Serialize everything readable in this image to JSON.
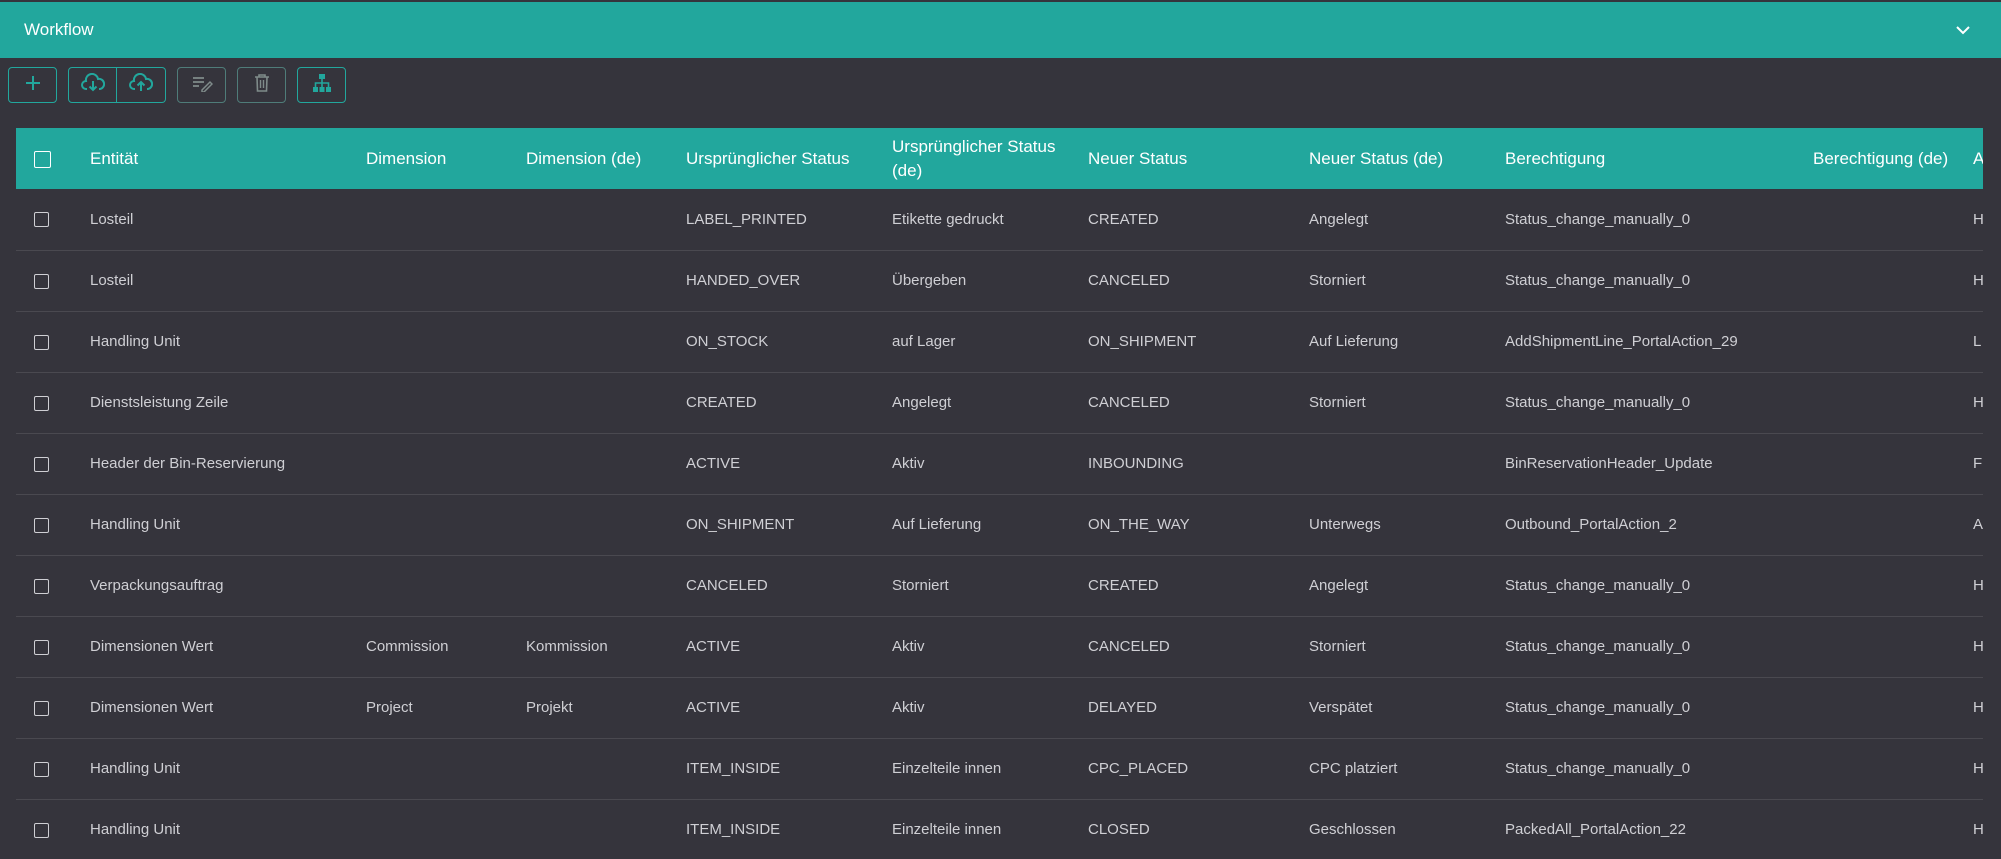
{
  "panel": {
    "title": "Workflow",
    "collapse_icon": "chevron-down-icon"
  },
  "toolbar": {
    "buttons": [
      {
        "name": "add-button",
        "icon": "plus-icon"
      },
      {
        "name": "download-button",
        "icon": "cloud-download-icon"
      },
      {
        "name": "upload-button",
        "icon": "cloud-upload-icon"
      },
      {
        "name": "edit-button",
        "icon": "edit-list-icon"
      },
      {
        "name": "delete-button",
        "icon": "trash-icon"
      },
      {
        "name": "hierarchy-button",
        "icon": "sitemap-icon"
      }
    ]
  },
  "colors": {
    "accent": "#22a79d",
    "background": "#35343c",
    "text": "#cfcfd4"
  },
  "table": {
    "columns": [
      "Entität",
      "Dimension",
      "Dimension (de)",
      "Ursprünglicher Status",
      "Ursprünglicher Status (de)",
      "Neuer Status",
      "Neuer Status (de)",
      "Berechtigung",
      "Berechtigung (de)",
      "A"
    ],
    "rows": [
      [
        "Losteil",
        "",
        "",
        "LABEL_PRINTED",
        "Etikette gedruckt",
        "CREATED",
        "Angelegt",
        "Status_change_manually_0",
        "",
        "H"
      ],
      [
        "Losteil",
        "",
        "",
        "HANDED_OVER",
        "Übergeben",
        "CANCELED",
        "Storniert",
        "Status_change_manually_0",
        "",
        "H"
      ],
      [
        "Handling Unit",
        "",
        "",
        "ON_STOCK",
        "auf Lager",
        "ON_SHIPMENT",
        "Auf Lieferung",
        "AddShipmentLine_PortalAction_29",
        "",
        "L"
      ],
      [
        "Dienstsleistung Zeile",
        "",
        "",
        "CREATED",
        "Angelegt",
        "CANCELED",
        "Storniert",
        "Status_change_manually_0",
        "",
        "H"
      ],
      [
        "Header der Bin-Reservierung",
        "",
        "",
        "ACTIVE",
        "Aktiv",
        "INBOUNDING",
        "",
        "BinReservationHeader_Update",
        "",
        "F"
      ],
      [
        "Handling Unit",
        "",
        "",
        "ON_SHIPMENT",
        "Auf Lieferung",
        "ON_THE_WAY",
        "Unterwegs",
        "Outbound_PortalAction_2",
        "",
        "A"
      ],
      [
        "Verpackungsauftrag",
        "",
        "",
        "CANCELED",
        "Storniert",
        "CREATED",
        "Angelegt",
        "Status_change_manually_0",
        "",
        "H"
      ],
      [
        "Dimensionen Wert",
        "Commission",
        "Kommission",
        "ACTIVE",
        "Aktiv",
        "CANCELED",
        "Storniert",
        "Status_change_manually_0",
        "",
        "H"
      ],
      [
        "Dimensionen Wert",
        "Project",
        "Projekt",
        "ACTIVE",
        "Aktiv",
        "DELAYED",
        "Verspätet",
        "Status_change_manually_0",
        "",
        "H"
      ],
      [
        "Handling Unit",
        "",
        "",
        "ITEM_INSIDE",
        "Einzelteile innen",
        "CPC_PLACED",
        "CPC platziert",
        "Status_change_manually_0",
        "",
        "H"
      ],
      [
        "Handling Unit",
        "",
        "",
        "ITEM_INSIDE",
        "Einzelteile innen",
        "CLOSED",
        "Geschlossen",
        "PackedAll_PortalAction_22",
        "",
        "H"
      ]
    ]
  }
}
